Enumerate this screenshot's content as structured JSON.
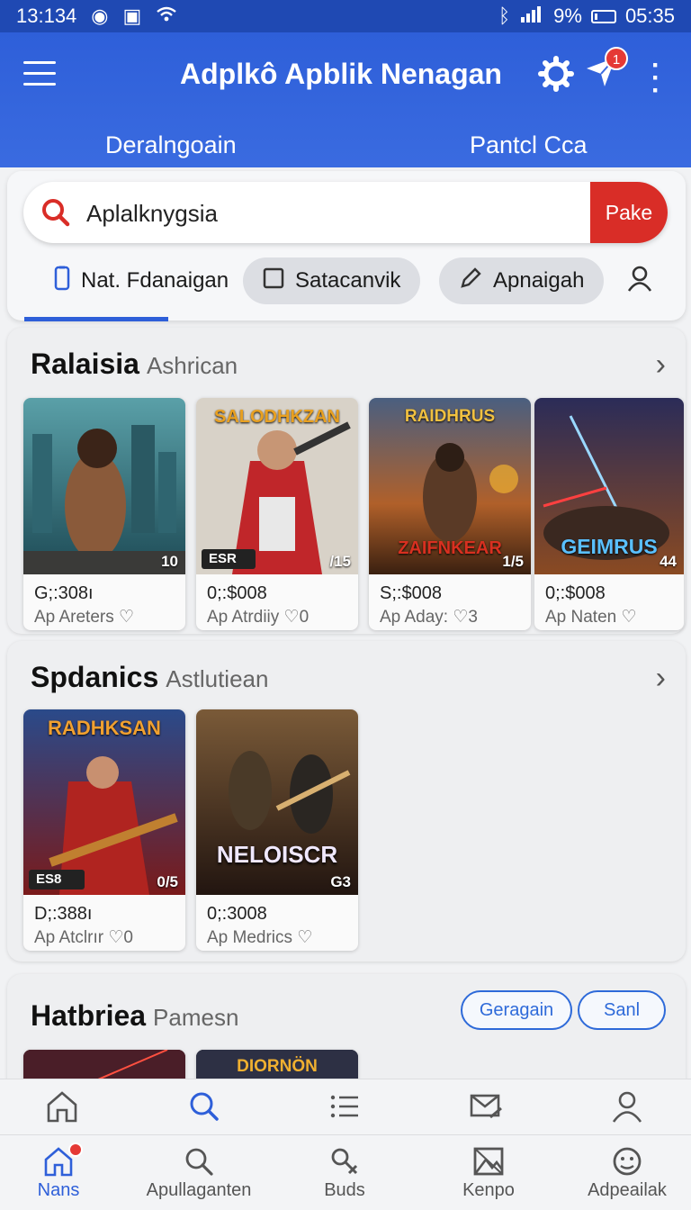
{
  "status_bar": {
    "time": "13:134",
    "battery": "9%",
    "clock": "05:35"
  },
  "app_bar": {
    "title": "Adplkô Apblik Nenagan",
    "notification_count": "1",
    "tabs": [
      {
        "label": "Deralngoain"
      },
      {
        "label": "Pantcl Cca"
      }
    ]
  },
  "search": {
    "value": "Aplalknygsia",
    "button_label": "Pake"
  },
  "filters": [
    {
      "label": "Nat. Fdanaigan",
      "icon": "phone-icon"
    },
    {
      "label": "Satacanvik",
      "icon": "checkbox-icon"
    },
    {
      "label": "Apnaigah",
      "icon": "pencil-icon"
    }
  ],
  "sections": [
    {
      "title": "Ralaisia",
      "subtitle": "Ashrican",
      "cards": [
        {
          "badge": "10",
          "label": "",
          "price": "G;:308ı",
          "meta": "Ap Areters"
        },
        {
          "badge": "/15",
          "label": "SALODHKZAN",
          "tag": "ESR",
          "price": "0;:$008",
          "meta": "Ap Atrdiiy",
          "meta_count": "0"
        },
        {
          "badge": "1/5",
          "label": "RAIDHRUS",
          "label2": "ZAIFNKEAR",
          "price": "S;:$008",
          "meta": "Ap Aday:",
          "meta_count": "3"
        },
        {
          "badge": "44",
          "label": "GEIMRUS",
          "price": "0;:$008",
          "meta": "Ap Naten"
        }
      ]
    },
    {
      "title": "Spdanics",
      "subtitle": "Astlutiean",
      "cards": [
        {
          "badge": "0/5",
          "label": "RADHKSAN",
          "tag": "ES8",
          "price": "D;:388ı",
          "meta": "Ap Atclrır",
          "meta_count": "0"
        },
        {
          "badge": "G3",
          "label": "NELOISCR",
          "price": "0;:3008",
          "meta": "Ap Medrics"
        }
      ]
    },
    {
      "title": "Hatbriea",
      "subtitle": "Pamesn",
      "pills": [
        "Geragain",
        "Sanl"
      ],
      "cards": [
        {
          "label": ""
        },
        {
          "label": "DIORNÖN"
        }
      ]
    }
  ],
  "nav_upper": [
    {
      "icon": "home-icon"
    },
    {
      "icon": "search-icon"
    },
    {
      "icon": "list-icon"
    },
    {
      "icon": "mail-edit-icon"
    },
    {
      "icon": "person-icon"
    }
  ],
  "nav_lower": [
    {
      "label": "Nans",
      "icon": "home-icon"
    },
    {
      "label": "Apullaganten",
      "icon": "search-icon"
    },
    {
      "label": "Buds",
      "icon": "tools-icon"
    },
    {
      "label": "Kenpo",
      "icon": "image-icon"
    },
    {
      "label": "Adpeailak",
      "icon": "face-icon"
    }
  ],
  "colors": {
    "primary": "#2e5fd9",
    "status_bar": "#1f49b3",
    "accent_red": "#d92d27",
    "badge_red": "#e53935"
  }
}
